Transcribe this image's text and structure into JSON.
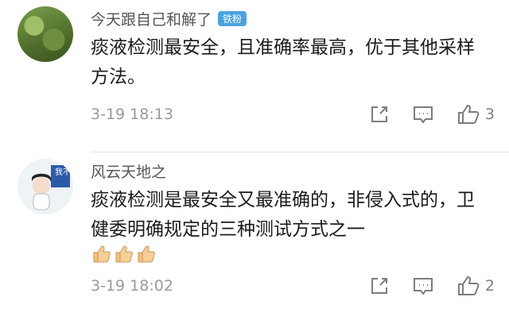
{
  "comments": [
    {
      "username": "今天跟自己和解了",
      "badge": "铁粉",
      "text": "痰液检测最安全，且准确率最高，优于其他采样方法。",
      "time": "3-19 18:13",
      "likes": "3",
      "avatar_icon": "grass-photo-avatar"
    },
    {
      "username": "风云天地之",
      "text": "痰液检测是最安全又最准确的，非侵入式的，卫健委明确规定的三种测试方式之一",
      "emojis": [
        "thumbs-up",
        "thumbs-up",
        "thumbs-up"
      ],
      "time": "3-19 18:02",
      "likes": "2",
      "avatar_icon": "girl-sticker-avatar",
      "avatar_text": "我不"
    }
  ],
  "icons": {
    "share": "share-icon",
    "comment": "comment-icon",
    "like": "thumbs-up-icon"
  }
}
